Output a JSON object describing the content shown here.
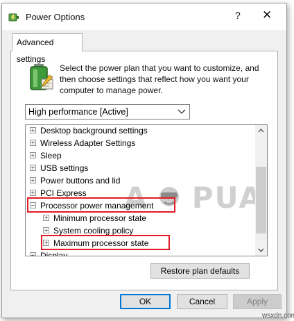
{
  "window": {
    "title": "Power Options",
    "help_glyph": "?",
    "close_glyph": "✕",
    "app_icon": "power-options-icon"
  },
  "tabs": [
    {
      "label": "Advanced settings",
      "selected": true
    }
  ],
  "intro": {
    "icon": "battery-plan-icon",
    "text": "Select the power plan that you want to customize, and then choose settings that reflect how you want your computer to manage power."
  },
  "plan_select": {
    "value": "High performance [Active]"
  },
  "settings_tree": {
    "items": [
      {
        "label": "Desktop background settings",
        "expander": "+"
      },
      {
        "label": "Wireless Adapter Settings",
        "expander": "+"
      },
      {
        "label": "Sleep",
        "expander": "+"
      },
      {
        "label": "USB settings",
        "expander": "+"
      },
      {
        "label": "Power buttons and lid",
        "expander": "+"
      },
      {
        "label": "PCI Express",
        "expander": "+"
      },
      {
        "label": "Processor power management",
        "expander": "−",
        "highlighted": true
      },
      {
        "label": "Minimum processor state",
        "expander": "+"
      },
      {
        "label": "System cooling policy",
        "expander": "+"
      },
      {
        "label": "Maximum processor state",
        "expander": "+",
        "highlighted": true
      },
      {
        "label": "Display",
        "expander": "+"
      }
    ]
  },
  "watermark": {
    "text_left": "A",
    "text_right": "PUALS"
  },
  "buttons": {
    "restore": "Restore plan defaults",
    "ok": "OK",
    "cancel": "Cancel",
    "apply": "Apply"
  },
  "credit": "wsxdn.com",
  "colors": {
    "highlight_box": "#e21b24",
    "accent": "#0078d7"
  }
}
